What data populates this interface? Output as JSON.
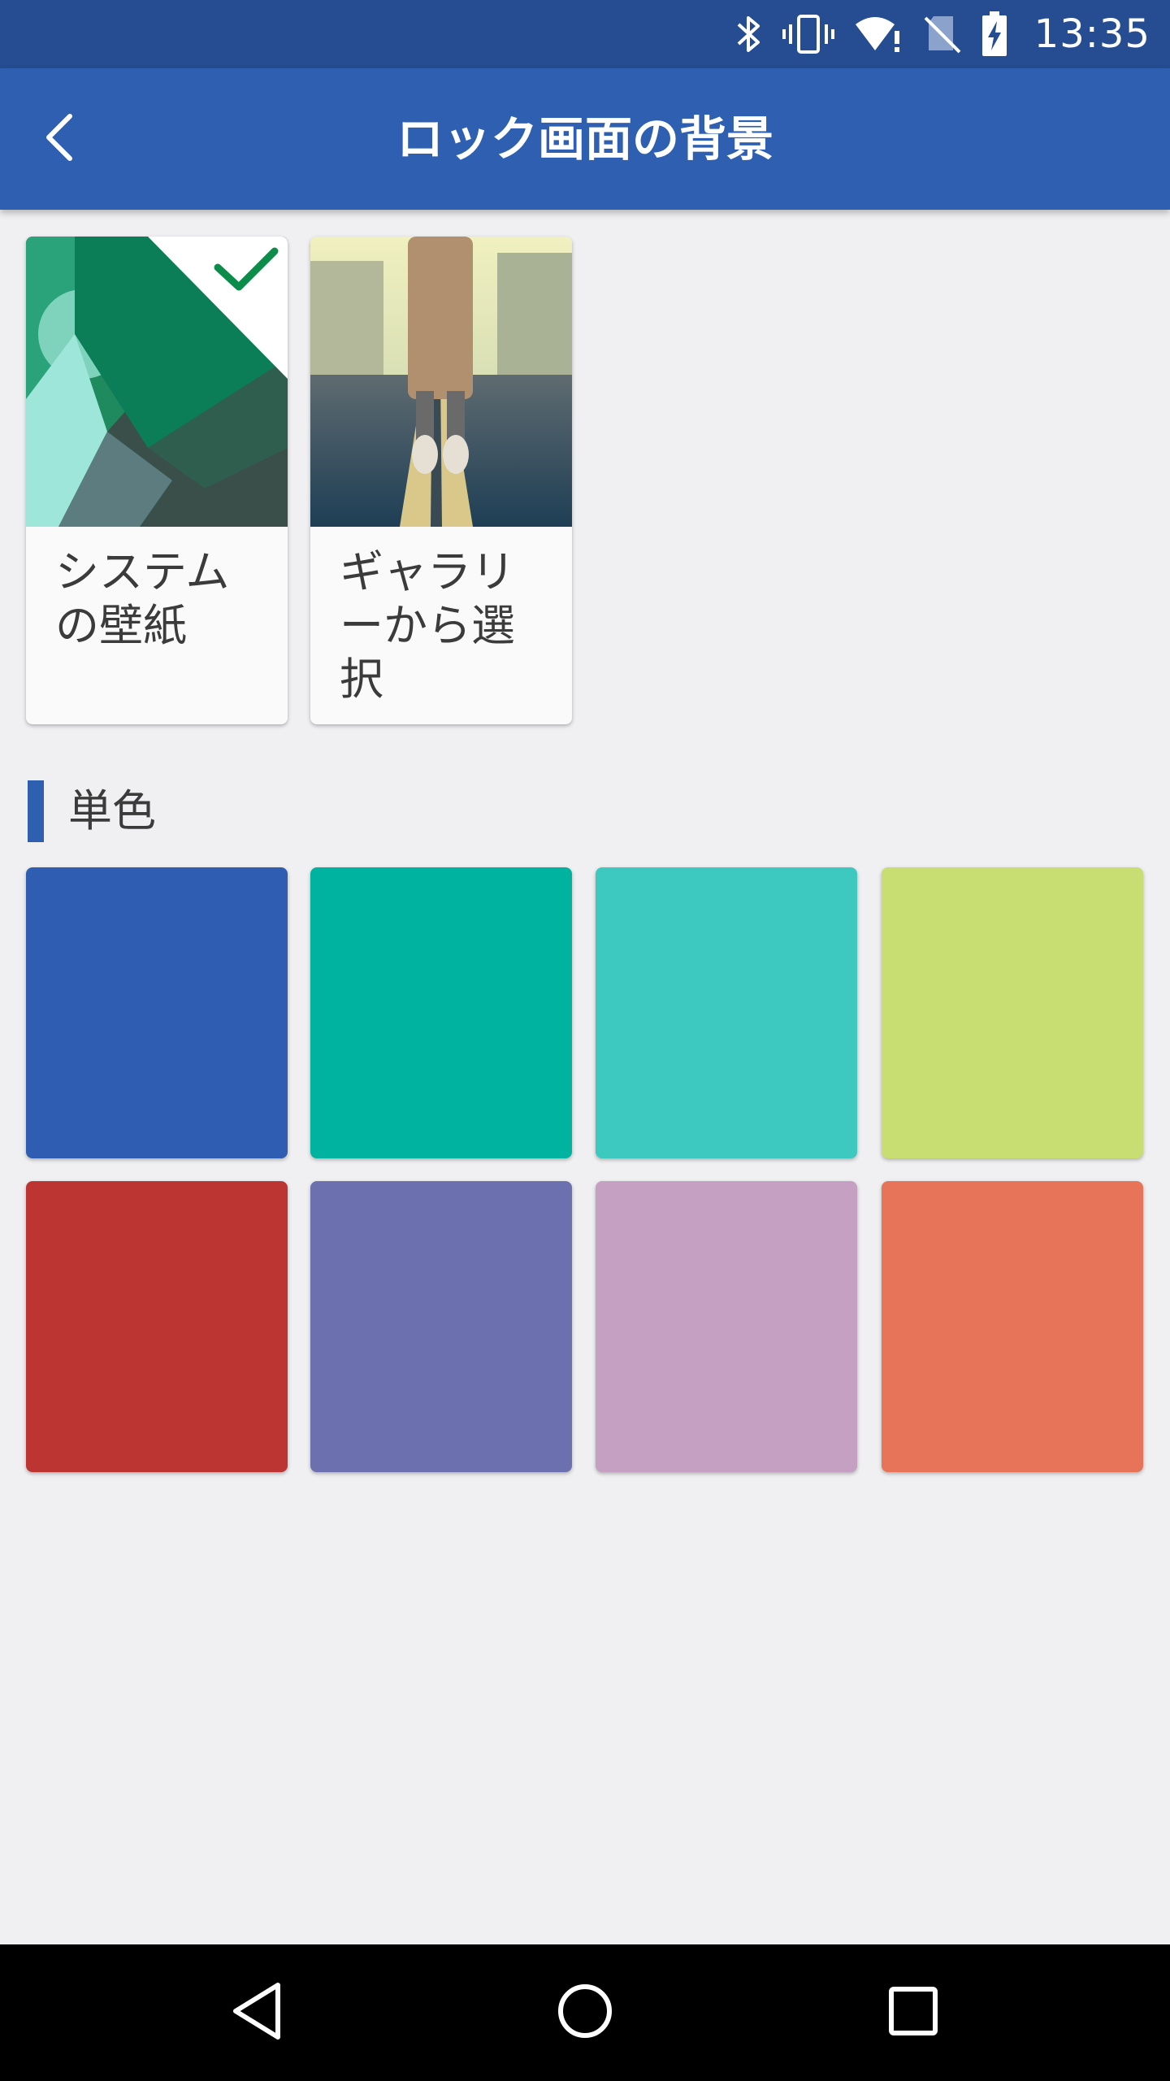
{
  "status_bar": {
    "time": "13:35",
    "icons": [
      "bluetooth-icon",
      "vibrate-icon",
      "wifi-alert-icon",
      "no-sim-icon",
      "battery-charging-icon"
    ]
  },
  "app_bar": {
    "title": "ロック画面の背景",
    "back_icon": "chevron-left-icon",
    "color": "#2e5fb1"
  },
  "wallpapers": [
    {
      "label": "システムの壁紙",
      "selected": true,
      "check_icon": "check-icon",
      "check_color": "#0c8c4a"
    },
    {
      "label": "ギャラリーから選択",
      "selected": false
    }
  ],
  "solid_colors": {
    "title": "単色",
    "swatches": [
      "#2f5db1",
      "#00b3a0",
      "#3dc8c0",
      "#c8dd72",
      "#bd3532",
      "#6c70ae",
      "#c6a0c2",
      "#e77358"
    ]
  },
  "nav_bar": {
    "back": "back-triangle-icon",
    "home": "home-circle-icon",
    "recents": "recents-square-icon"
  }
}
